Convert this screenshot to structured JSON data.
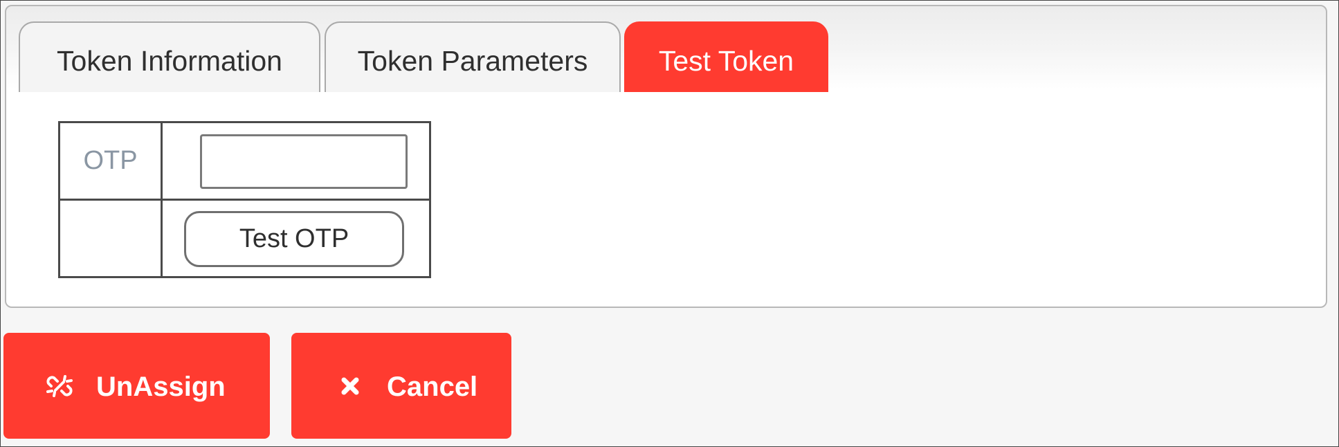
{
  "tabs": [
    {
      "label": "Token Information",
      "active": false
    },
    {
      "label": "Token Parameters",
      "active": false
    },
    {
      "label": "Test Token",
      "active": true
    }
  ],
  "test_token": {
    "otp_label": "OTP",
    "otp_value": "",
    "test_button_label": "Test OTP"
  },
  "actions": {
    "unassign_label": "UnAssign",
    "unassign_icon": "unlink-icon",
    "cancel_label": "Cancel",
    "cancel_icon": "close-icon"
  },
  "colors": {
    "accent": "#ff3b30",
    "tab_text": "#2f2f2f",
    "label_muted": "#8a96a3"
  }
}
